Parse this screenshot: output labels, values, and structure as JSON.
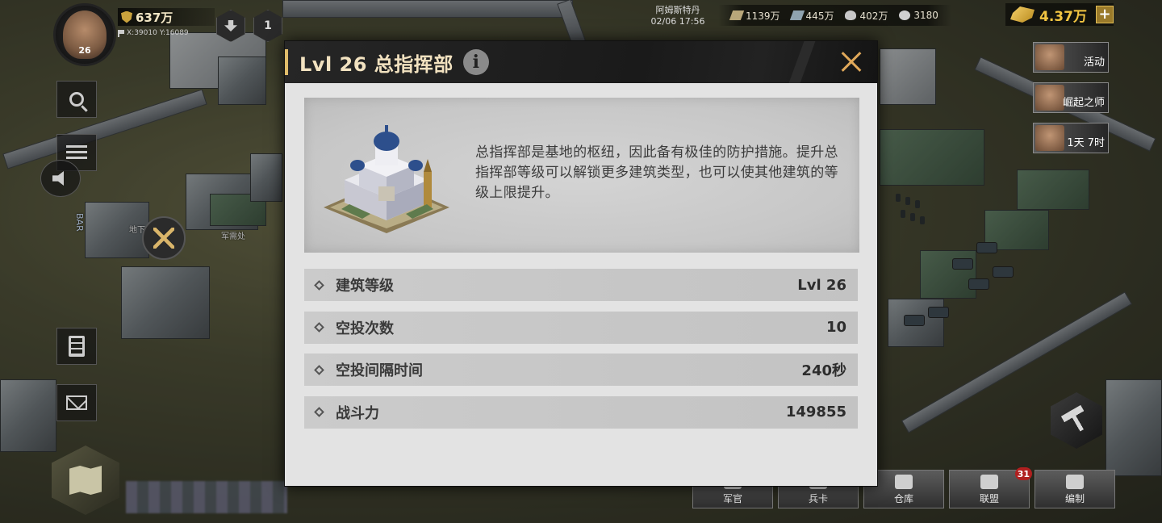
{
  "hud": {
    "avatar_level": "26",
    "power": "637万",
    "coords": "X:39010 Y:16089",
    "queue_count": "1",
    "city_name": "阿姆斯特丹",
    "datetime": "02/06 17:56",
    "resources": [
      {
        "icon": "iron-icon",
        "amount": "1139万"
      },
      {
        "icon": "steel-icon",
        "amount": "445万"
      },
      {
        "icon": "oil-icon",
        "amount": "402万"
      },
      {
        "icon": "gear-icon",
        "amount": "3180"
      }
    ],
    "gold": "4.37万",
    "gold_plus": "+"
  },
  "events": [
    {
      "label": "活动"
    },
    {
      "label": "崛起之师"
    },
    {
      "label": "1天 7时"
    }
  ],
  "map_labels": {
    "bar_sign": "BAR",
    "underground": "地下",
    "supply": "军需处"
  },
  "bottom_nav": [
    {
      "label": "军官",
      "badge": ""
    },
    {
      "label": "兵卡",
      "badge": ""
    },
    {
      "label": "仓库",
      "badge": ""
    },
    {
      "label": "联盟",
      "badge": "31"
    },
    {
      "label": "编制",
      "badge": ""
    }
  ],
  "modal": {
    "title": "Lvl 26 总指挥部",
    "info_glyph": "i",
    "description": "总指挥部是基地的枢纽，因此备有极佳的防护措施。提升总指挥部等级可以解锁更多建筑类型，也可以使其他建筑的等级上限提升。",
    "stats": [
      {
        "label": "建筑等级",
        "value": "Lvl 26"
      },
      {
        "label": "空投次数",
        "value": "10"
      },
      {
        "label": "空投间隔时间",
        "value": "240秒"
      },
      {
        "label": "战斗力",
        "value": "149855"
      }
    ]
  },
  "colors": {
    "title_text": "#f2e2c0",
    "accent": "#e0bd6a",
    "gold": "#f2c542",
    "badge": "#b01f1f",
    "panel_bg": "#e3e3e3"
  }
}
